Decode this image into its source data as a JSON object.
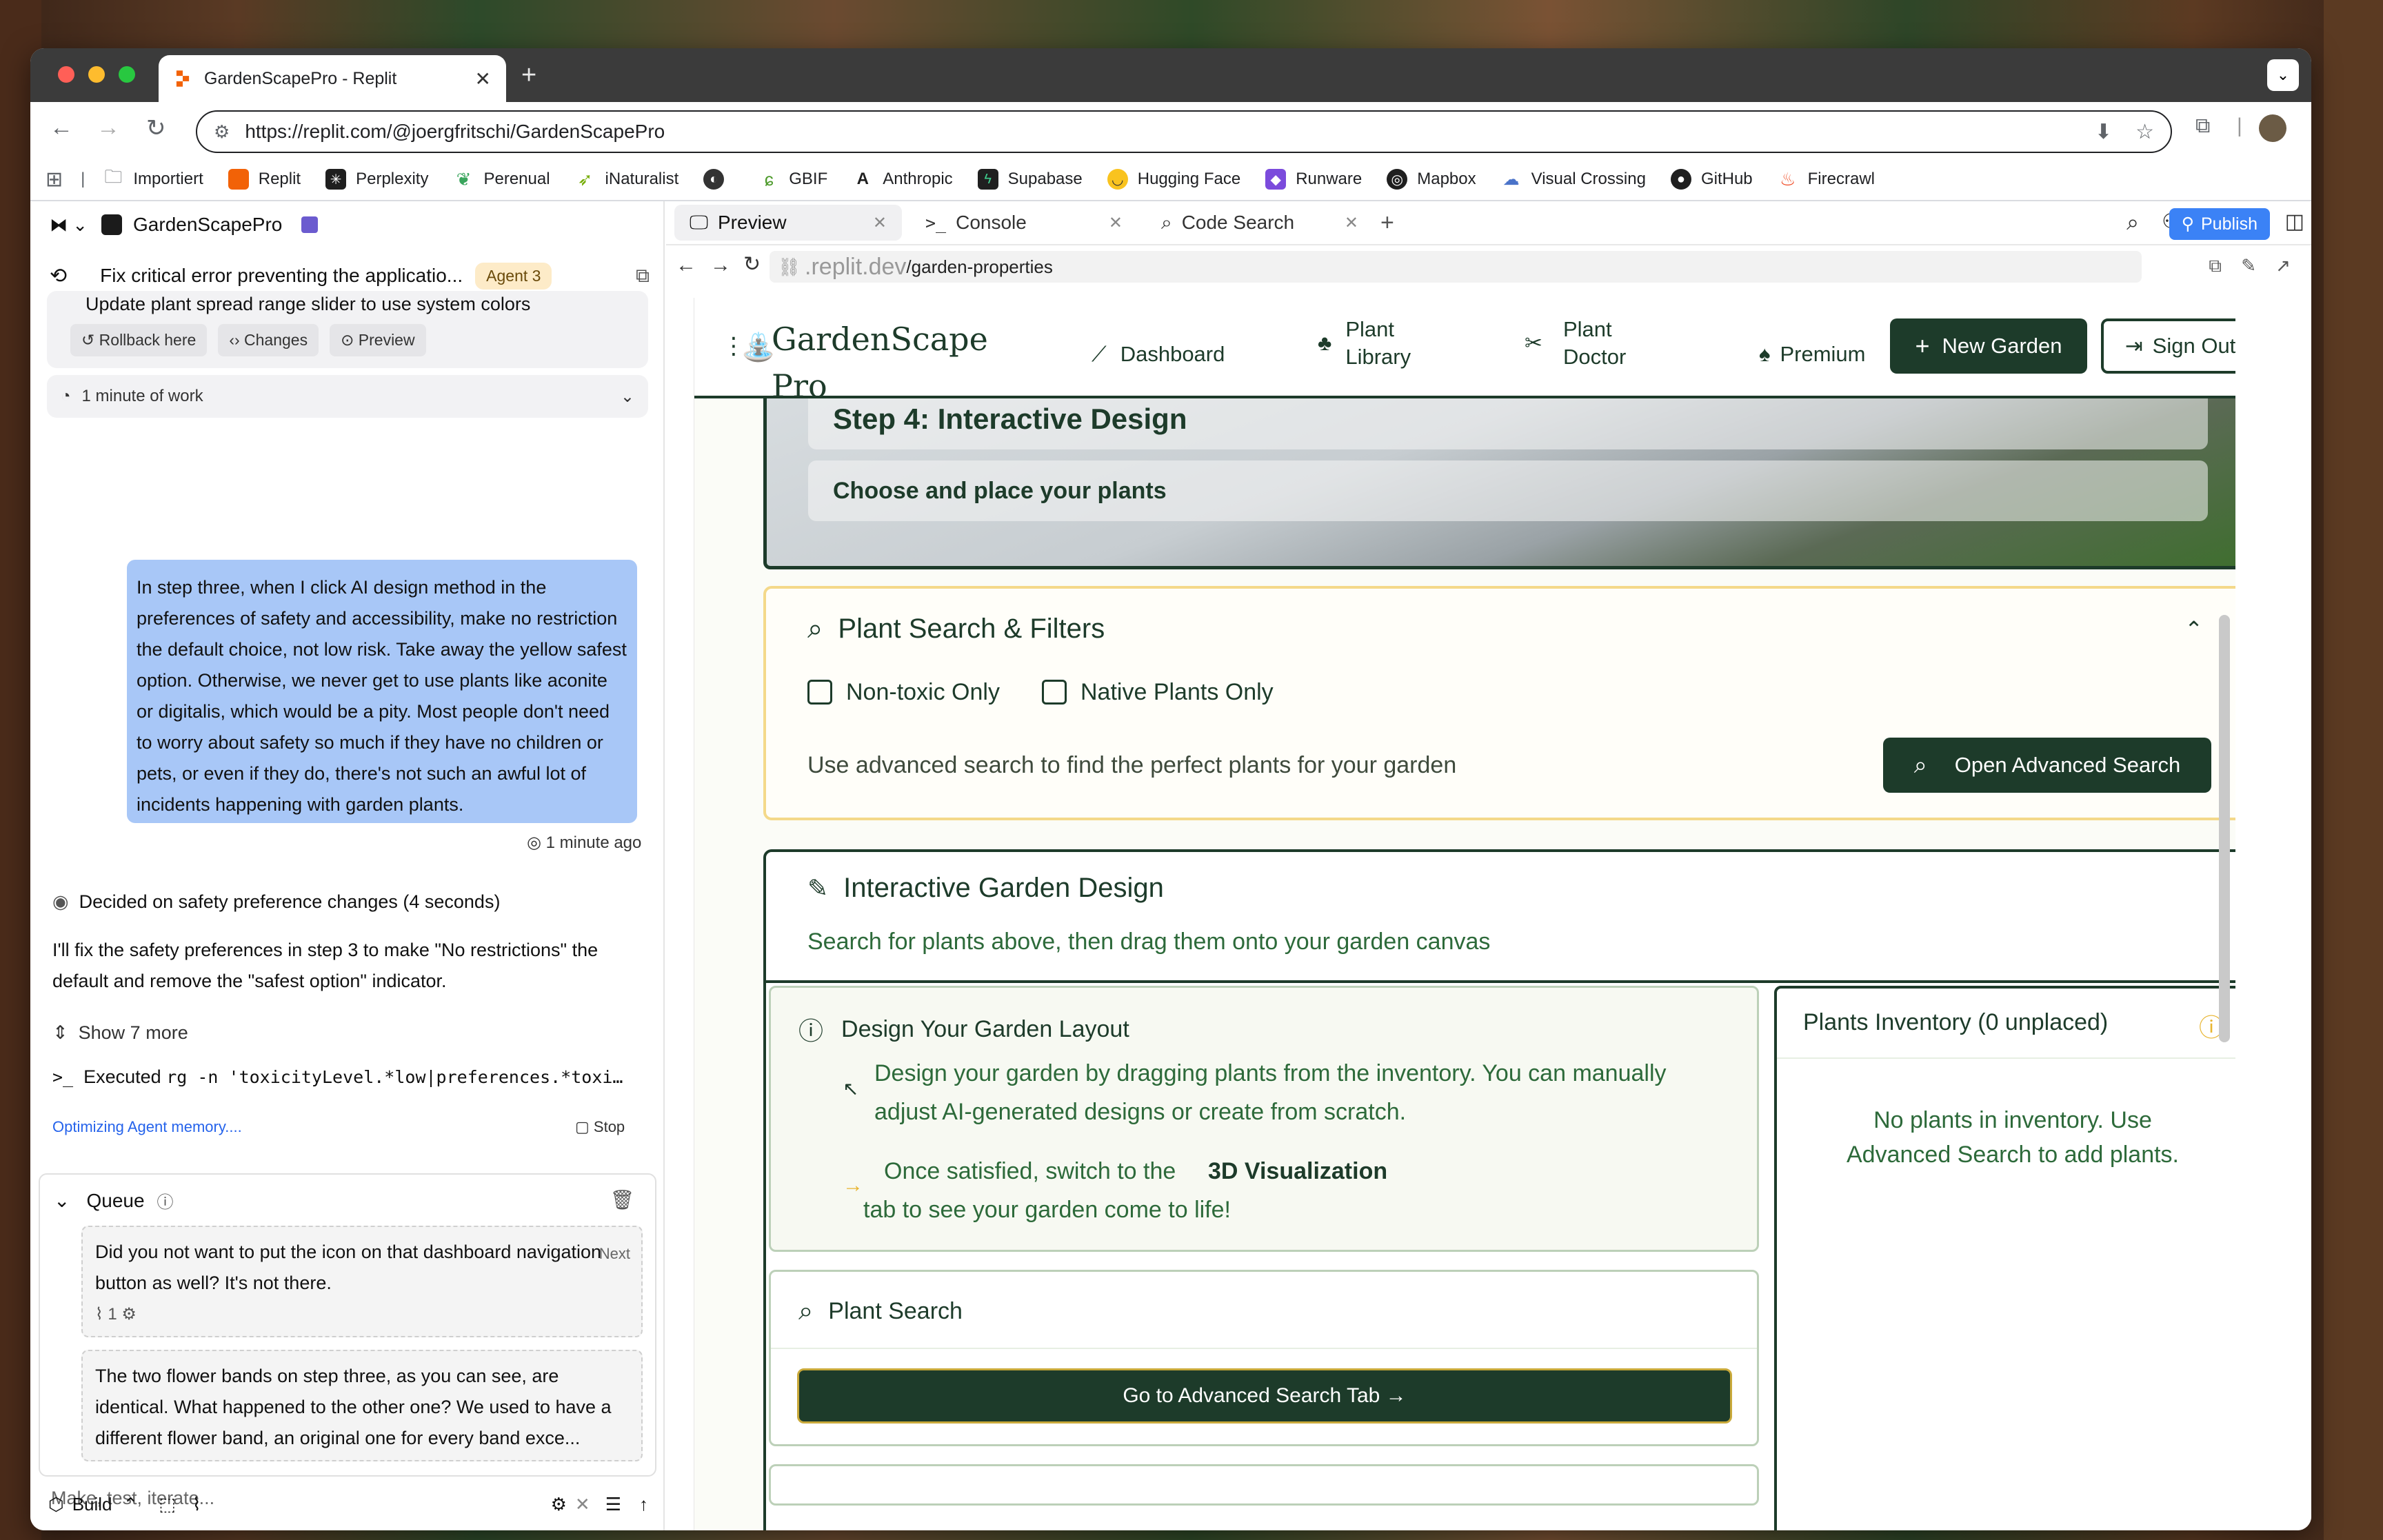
{
  "browser": {
    "tab_title": "GardenScapePro - Replit",
    "url": "https://replit.com/@joergfritschi/GardenScapePro",
    "bookmarks": [
      {
        "label": "Importiert",
        "icon": "folder-icon",
        "color": "#5f6368"
      },
      {
        "label": "Replit",
        "icon": "replit-icon",
        "color": "#f26207"
      },
      {
        "label": "Perplexity",
        "icon": "perplexity-icon",
        "color": "#1f1f1f"
      },
      {
        "label": "Perenual",
        "icon": "leaf-icon",
        "color": "#3aa55d"
      },
      {
        "label": "iNaturalist",
        "icon": "bird-icon",
        "color": "#74ac00"
      },
      {
        "label": "",
        "icon": "globe-icon",
        "color": "#333333"
      },
      {
        "label": "GBIF",
        "icon": "gbif-icon",
        "color": "#4c9a2a"
      },
      {
        "label": "Anthropic",
        "icon": "anthropic-icon",
        "color": "#1f1f1f"
      },
      {
        "label": "Supabase",
        "icon": "supabase-icon",
        "color": "#1f1f1f"
      },
      {
        "label": "Hugging Face",
        "icon": "hugging-face-icon",
        "color": "#f9c31f"
      },
      {
        "label": "Runware",
        "icon": "runware-icon",
        "color": "#7b4bdc"
      },
      {
        "label": "Mapbox",
        "icon": "mapbox-icon",
        "color": "#1f1f1f"
      },
      {
        "label": "Visual Crossing",
        "icon": "cloud-icon",
        "color": "#4a73c9"
      },
      {
        "label": "GitHub",
        "icon": "github-icon",
        "color": "#1f1f1f"
      },
      {
        "label": "Firecrawl",
        "icon": "flame-icon",
        "color": "#f04a23"
      }
    ]
  },
  "left": {
    "project_name": "GardenScapePro",
    "thread_title": "Fix critical error preventing the applicatio...",
    "agent_badge": "Agent 3",
    "checkpoint_text": "Update plant spread range slider to use system colors",
    "chips": [
      "Rollback here",
      "Changes",
      "Preview"
    ],
    "work_time": "1 minute of work",
    "user_message": "In step three, when I click AI design method in the preferences of safety and accessibility, make no restriction the default choice, not low risk. Take away the yellow safest option. Otherwise, we never get to use plants like aconite or digitalis, which would be a pity. Most people don't need to worry about safety so much if they have no children or pets, or even if they do, there's not such an awful lot of incidents happening with garden plants.",
    "user_time": "1 minute ago",
    "decided": "Decided on safety preference changes (4 seconds)",
    "agent_reply": "I'll fix the safety preferences in step 3 to make \"No restrictions\" the default and remove the \"safest option\" indicator.",
    "show_more": "Show 7 more",
    "executed_prefix": "Executed",
    "executed_cmd": "rg -n 'toxicityLevel.*low|preferences.*toxi…",
    "optimizing": "Optimizing Agent memory....",
    "stop": "Stop",
    "queue_label": "Queue",
    "queue_items": [
      {
        "text": "Did you not want to put the icon on that dashboard navigation button as well? It's not there.",
        "tag": "Next",
        "attachments": "1"
      },
      {
        "text": "The two flower bands on step three, as you can see, are identical. What happened to the other one? We used to have a different flower band, an original one for every band exce..."
      }
    ],
    "composer_placeholder": "Make, test, iterate...",
    "build_label": "Build"
  },
  "right": {
    "tabs": [
      {
        "label": "Preview",
        "icon": "monitor-icon"
      },
      {
        "label": "Console",
        "icon": "terminal-icon"
      },
      {
        "label": "Code Search",
        "icon": "search-icon"
      }
    ],
    "publish": "Publish",
    "preview_url_dim": ".replit.dev",
    "preview_url_path": "/garden-properties"
  },
  "app": {
    "brand_line1": "GardenScape",
    "brand_line2": "Pro",
    "nav": [
      {
        "label": "Dashboard",
        "icon": "trowel-icon"
      },
      {
        "label_line1": "Plant",
        "label_line2": "Library",
        "icon": "pot-icon"
      },
      {
        "label_line1": "Plant",
        "label_line2": "Doctor",
        "icon": "shears-icon"
      },
      {
        "label": "Premium",
        "icon": "watering-can-icon"
      }
    ],
    "new_garden": "New Garden",
    "sign_out": "Sign Out",
    "hero_title": "Step 4: Interactive Design",
    "hero_subtitle": "Choose and place your plants",
    "filters_title": "Plant Search & Filters",
    "nontoxic": "Non-toxic Only",
    "native": "Native Plants Only",
    "filters_hint": "Use advanced search to find the perfect plants for your garden",
    "open_advanced": "Open Advanced Search",
    "design_title": "Interactive Garden Design",
    "design_subtitle": "Search for plants above, then drag them onto your garden canvas",
    "layout_title": "Design Your Garden Layout",
    "layout_text": "Design your garden by dragging plants from the inventory. You can manually adjust AI-generated designs or create from scratch.",
    "tip_a": "Once satisfied, switch to the",
    "tip_b": "3D Visualization",
    "tip_c": "tab to see your garden come to life!",
    "inventory_title": "Plants Inventory (0 unplaced)",
    "inventory_empty": "No plants in inventory. Use Advanced Search to add plants.",
    "plant_search": "Plant Search",
    "goto_advanced": "Go to Advanced Search Tab →",
    "colors": {
      "brand_green": "#1d3b2a",
      "accent_yellow": "#f4c542"
    }
  }
}
